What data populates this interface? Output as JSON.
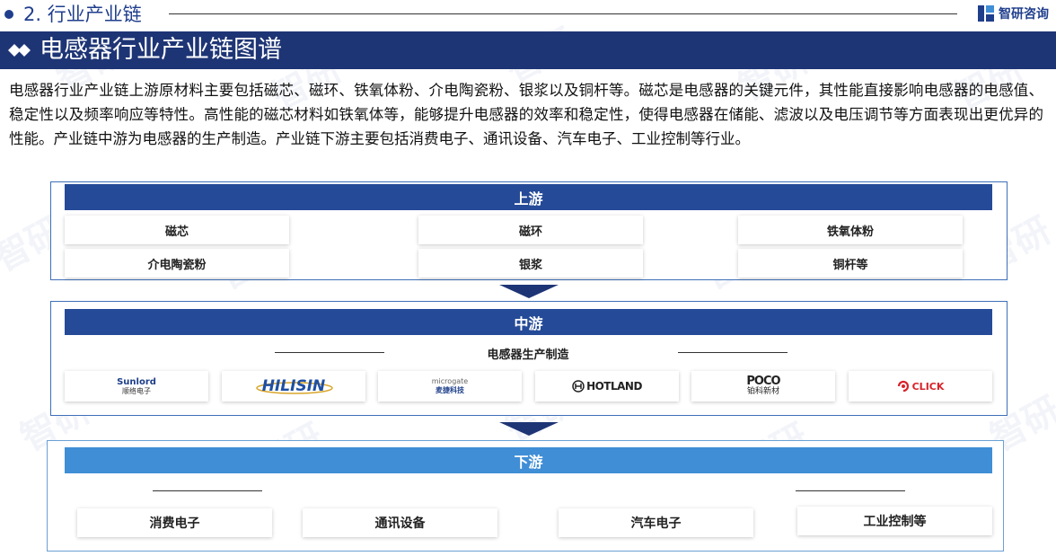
{
  "header": {
    "section_title": "2. 行业产业链",
    "brand": "智研咨询"
  },
  "banner": {
    "title": "电感器行业产业链图谱"
  },
  "intro": "电感器行业产业链上游原材料主要包括磁芯、磁环、铁氧体粉、介电陶瓷粉、银浆以及铜杆等。磁芯是电感器的关键元件，其性能直接影响电感器的电感值、稳定性以及频率响应等特性。高性能的磁芯材料如铁氧体等，能够提升电感器的效率和稳定性，使得电感器在储能、滤波以及电压调节等方面表现出更优异的性能。产业链中游为电感器的生产制造。产业链下游主要包括消费电子、通讯设备、汽车电子、工业控制等行业。",
  "upstream": {
    "title": "上游",
    "items": [
      "磁芯",
      "磁环",
      "铁氧体粉",
      "介电陶瓷粉",
      "银浆",
      "铜杆等"
    ]
  },
  "midstream": {
    "title": "中游",
    "subtitle": "电感器生产制造",
    "logos": {
      "sunlord": {
        "en": "Sunlord",
        "cn": "顺络电子"
      },
      "hilisin": {
        "en": "HILISIN"
      },
      "microgate": {
        "en": "microgate",
        "cn": "麦捷科技"
      },
      "hotland": {
        "en": "HOTLAND"
      },
      "poco": {
        "en": "POCO",
        "cn": "铂科新材"
      },
      "click": {
        "en": "CLICK"
      }
    }
  },
  "downstream": {
    "title": "下游",
    "items": [
      "消费电子",
      "通讯设备",
      "汽车电子",
      "工业控制等"
    ]
  },
  "colors": {
    "navy": "#1e3575",
    "panel_header": "#254a97",
    "downstream_header": "#3f8ed6",
    "brand_blue": "#1f3e8c"
  }
}
